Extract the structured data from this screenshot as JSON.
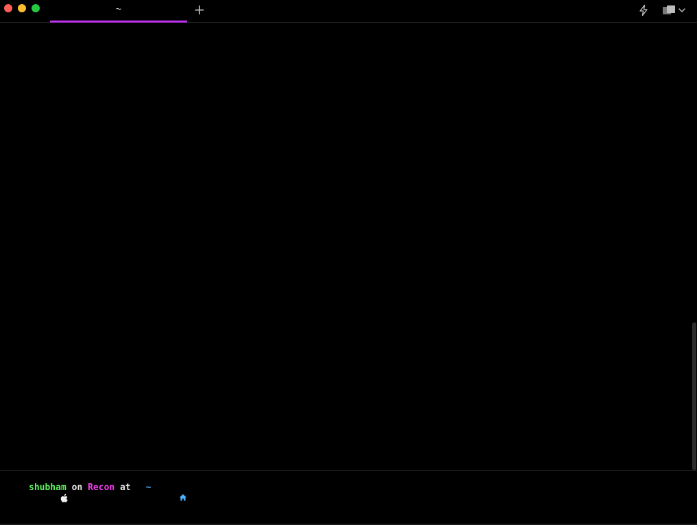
{
  "window": {
    "traffic_lights": {
      "close_color": "#ff5f57",
      "minimize_color": "#febc2e",
      "zoom_color": "#28c840"
    }
  },
  "tabs": [
    {
      "label": "~",
      "active": true,
      "accent_color": "#c034f0"
    }
  ],
  "toolbar": {
    "new_tab_label": "+",
    "icons": [
      "new-tab-icon",
      "lightning-bolt-icon",
      "panes-icon",
      "chevron-down-icon"
    ]
  },
  "prompt": {
    "os_icon": "apple-icon",
    "user": "shubham",
    "on_word": "on",
    "branch": "Recon",
    "at_word": "at",
    "dir_icon": "home-icon",
    "dir": "~",
    "colors": {
      "user": "#5ff35f",
      "branch": "#f03ee9",
      "dir": "#4db3ff"
    }
  }
}
